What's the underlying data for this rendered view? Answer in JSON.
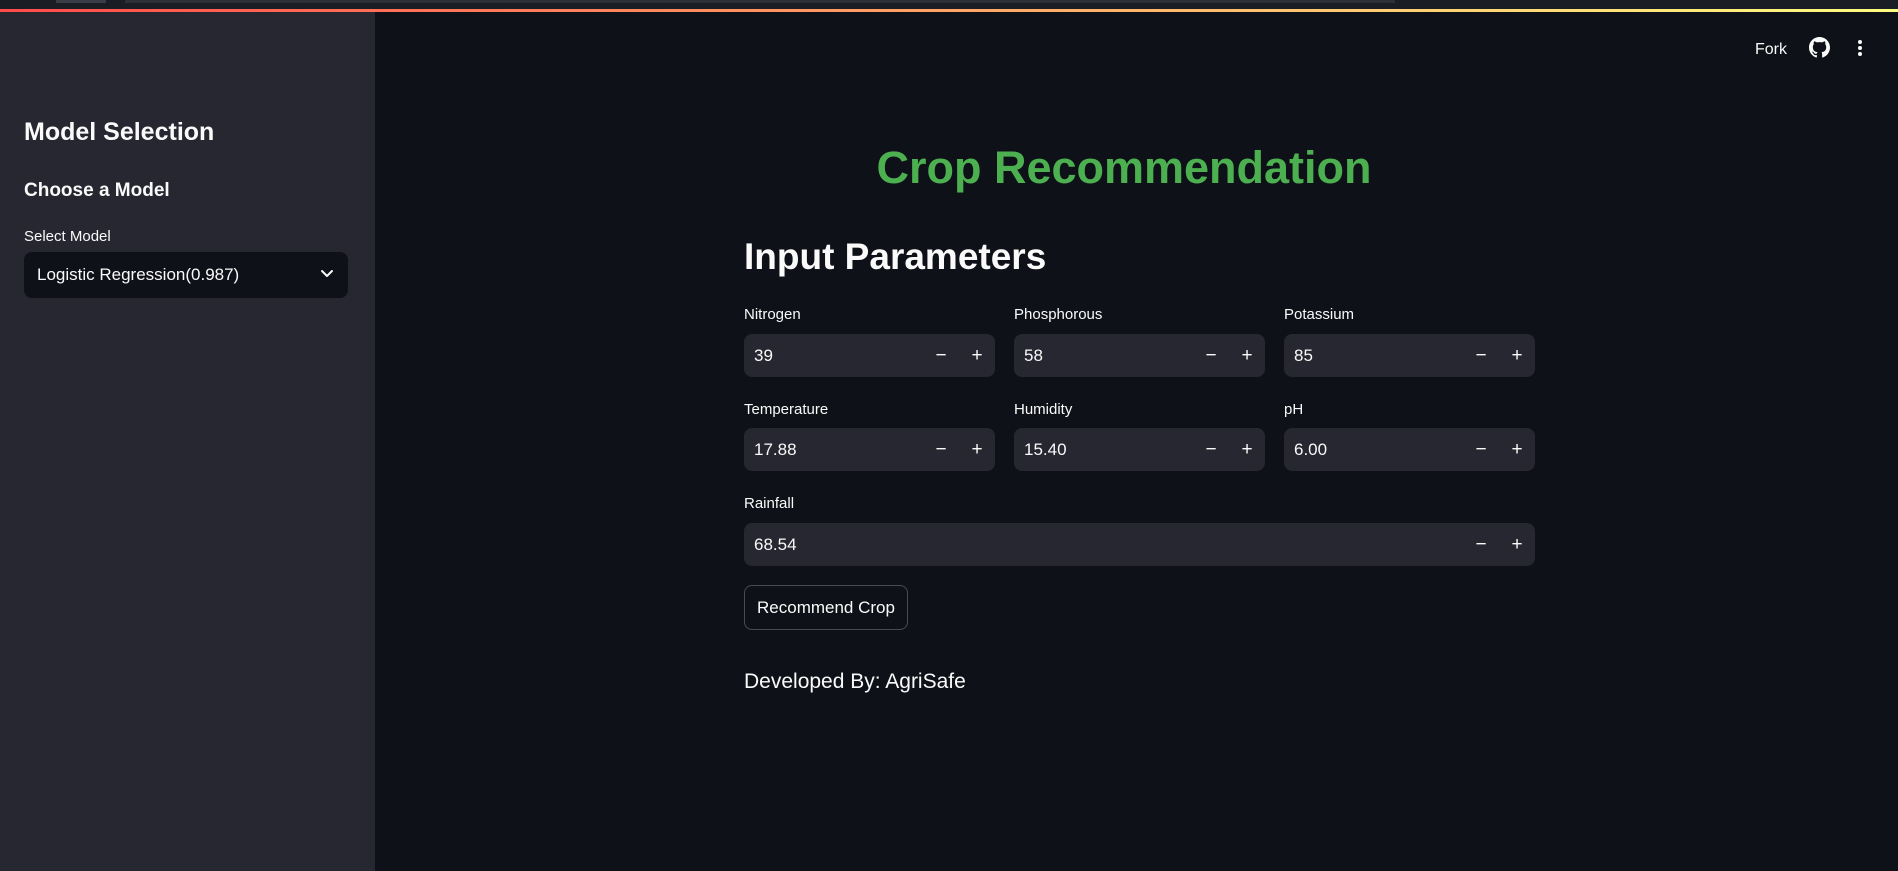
{
  "sidebar": {
    "title": "Model Selection",
    "subtitle": "Choose a Model",
    "select_label": "Select Model",
    "selected_model": "Logistic Regression(0.987)"
  },
  "header": {
    "fork_label": "Fork"
  },
  "main": {
    "title": "Crop Recommendation",
    "section_title": "Input Parameters",
    "fields": {
      "nitrogen": {
        "label": "Nitrogen",
        "value": "39"
      },
      "phosphorous": {
        "label": "Phosphorous",
        "value": "58"
      },
      "potassium": {
        "label": "Potassium",
        "value": "85"
      },
      "temperature": {
        "label": "Temperature",
        "value": "17.88"
      },
      "humidity": {
        "label": "Humidity",
        "value": "15.40"
      },
      "ph": {
        "label": "pH",
        "value": "6.00"
      },
      "rainfall": {
        "label": "Rainfall",
        "value": "68.54"
      }
    },
    "stepper": {
      "minus": "−",
      "plus": "+"
    },
    "button_label": "Recommend Crop",
    "footer": "Developed By: AgriSafe"
  },
  "colors": {
    "title_green": "#4caf50",
    "background": "#0e1117",
    "sidebar": "#262730"
  }
}
